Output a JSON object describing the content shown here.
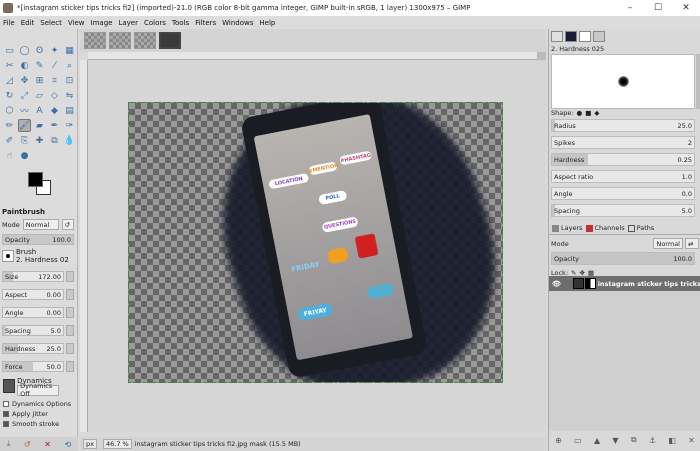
{
  "window": {
    "title": "*[instagram sticker tips tricks fi2] (imported)-21.0 (RGB color 8-bit gamma integer, GIMP built-in sRGB, 1 layer) 1300x975 – GIMP",
    "minimize": "–",
    "maximize": "☐",
    "close": "✕"
  },
  "menu": [
    "File",
    "Edit",
    "Select",
    "View",
    "Image",
    "Layer",
    "Colors",
    "Tools",
    "Filters",
    "Windows",
    "Help"
  ],
  "tool_options": {
    "title": "Paintbrush",
    "mode_label": "Mode",
    "mode_value": "Normal",
    "opacity_label": "Opacity",
    "opacity_value": "100.0",
    "brush_label": "Brush",
    "brush_value": "2. Hardness 02",
    "size_label": "Size",
    "size_value": "172.00",
    "aspect_label": "Aspect",
    "aspect_value": "0.00",
    "angle_label": "Angle",
    "angle_value": "0.00",
    "spacing_label": "Spacing",
    "spacing_value": "5.0",
    "hardness_label": "Hardness",
    "hardness_value": "25.0",
    "force_label": "Force",
    "force_value": "50.0",
    "dynamics_label": "Dynamics",
    "dynamics_value": "Dynamics Off",
    "dynamics_options": "Dynamics Options",
    "apply_jitter": "Apply Jitter",
    "smooth_stroke": "Smooth stroke"
  },
  "statusbar": {
    "unit": "px",
    "zoom": "46.7 %",
    "message": "instagram sticker tips tricks fi2.jpg mask (15.5 MB)"
  },
  "brush_panel": {
    "brush_name": "2. Hardness 025",
    "shape_label": "Shape:",
    "props": [
      {
        "label": "Radius",
        "value": "25.0",
        "fill": 0.25
      },
      {
        "label": "Spikes",
        "value": "2",
        "fill": 0.0
      },
      {
        "label": "Hardness",
        "value": "0.25",
        "fill": 0.25
      },
      {
        "label": "Aspect ratio",
        "value": "1.0",
        "fill": 0.0
      },
      {
        "label": "Angle",
        "value": "0.0",
        "fill": 0.0
      },
      {
        "label": "Spacing",
        "value": "5.0",
        "fill": 0.02
      }
    ]
  },
  "layers_panel": {
    "tab_layers": "Layers",
    "tab_channels": "Channels",
    "tab_paths": "Paths",
    "mode_label": "Mode",
    "mode_value": "Normal",
    "opacity_label": "Opacity",
    "opacity_value": "100.0",
    "lock_label": "Lock:",
    "layer_name": "instagram sticker tips tricks"
  },
  "stickers": {
    "location": "LOCATION",
    "hashtag": "#HASHTAG",
    "mention": "@MENTION",
    "poll": "POLL",
    "questions": "QUESTIONS",
    "friday": "FRIDAY",
    "friyay": "FRIYAY"
  },
  "colors": {
    "accent_green": "#3c8a3c",
    "fg": "#000000",
    "bg": "#ffffff",
    "layer_selected": "#6e6e6e"
  }
}
